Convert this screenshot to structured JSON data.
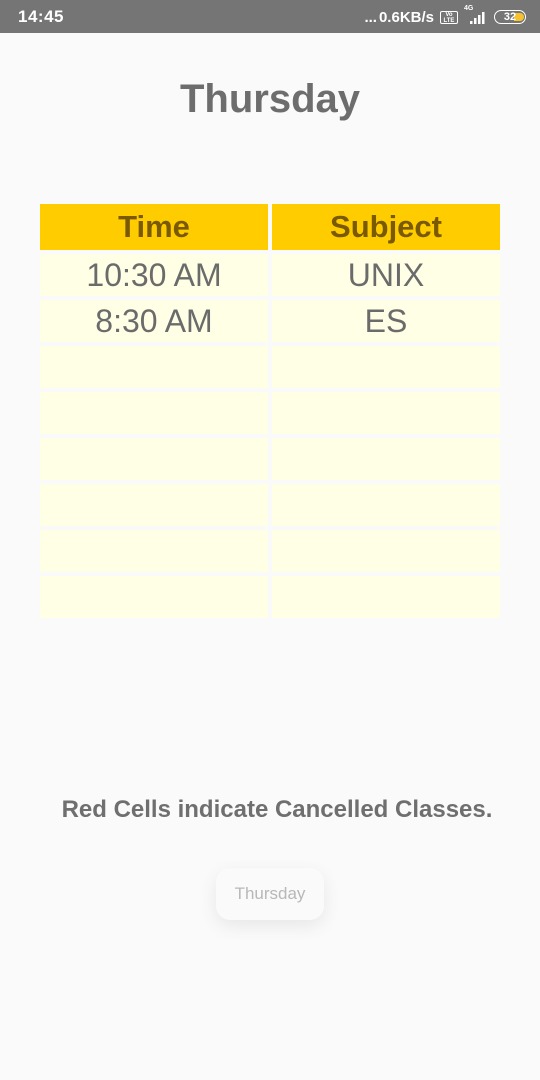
{
  "status_bar": {
    "time": "14:45",
    "more_dots": "...",
    "net_speed": "0.6KB/s",
    "volte": "Vo LTE",
    "network_type": "4G",
    "battery_level": "32"
  },
  "page": {
    "title": "Thursday"
  },
  "timetable": {
    "headers": [
      "Time",
      "Subject"
    ],
    "rows": [
      [
        "10:30 AM",
        "UNIX"
      ],
      [
        "8:30 AM",
        "ES"
      ],
      [
        "",
        ""
      ],
      [
        "",
        ""
      ],
      [
        "",
        ""
      ],
      [
        "",
        ""
      ],
      [
        "",
        ""
      ],
      [
        "",
        ""
      ]
    ]
  },
  "footer": {
    "note": "Red Cells indicate Cancelled Classes."
  },
  "toast": {
    "text": "Thursday"
  },
  "colors": {
    "header_bg": "#ffcc00",
    "header_text": "#7a5a00",
    "cell_bg": "#ffffe6",
    "status_bar_bg": "#757575",
    "battery_accent": "#f5c12e"
  }
}
